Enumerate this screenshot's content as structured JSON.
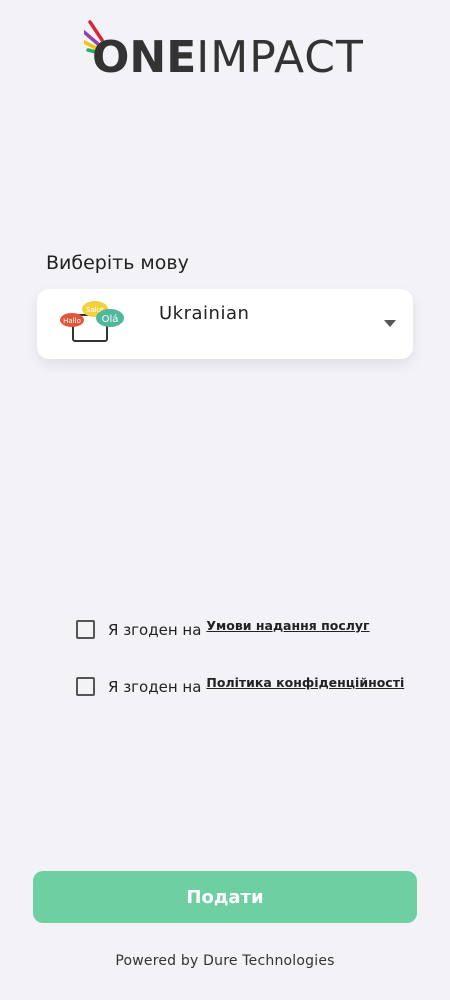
{
  "brand": {
    "name_part1": "ONE",
    "name_part2": "IMPACT"
  },
  "language": {
    "label": "Виберіть мову",
    "selected": "Ukrainian",
    "icon_bubbles": [
      "Hallo",
      "Salut",
      "Olá"
    ]
  },
  "agreements": [
    {
      "prefix": "Я згоден на",
      "link": "Умови надання послуг"
    },
    {
      "prefix": "Я згоден на",
      "link": "Політика конфіденційності"
    }
  ],
  "submit_label": "Подати",
  "footer": "Powered by Dure Technologies",
  "colors": {
    "background": "#f2f2f7",
    "accent": "#6dcfa2",
    "text": "#222222"
  }
}
